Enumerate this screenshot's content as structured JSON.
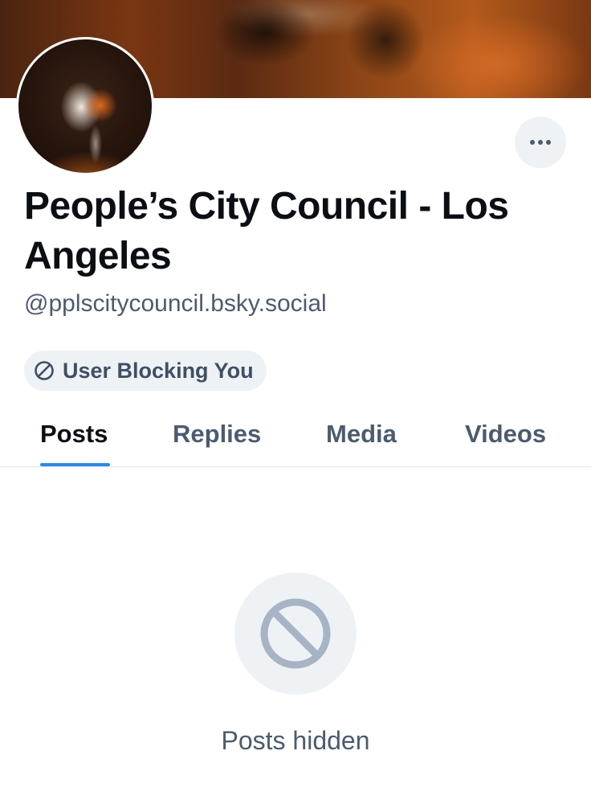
{
  "profile": {
    "display_name": "People’s City Council - Los Angeles",
    "handle": "@pplscitycouncil.bsky.social",
    "blocking_badge": "User Blocking You",
    "more_icon": "ellipsis-icon"
  },
  "tabs": [
    {
      "label": "Posts",
      "active": true
    },
    {
      "label": "Replies",
      "active": false
    },
    {
      "label": "Media",
      "active": false
    },
    {
      "label": "Videos",
      "active": false
    }
  ],
  "empty_state": {
    "icon": "prohibited-icon",
    "message": "Posts hidden"
  },
  "colors": {
    "accent": "#208bfe",
    "text_primary": "#0b0f14",
    "text_secondary": "#4b5b70",
    "chip_bg": "#eef2f5",
    "icon_muted": "#a7b4c6"
  }
}
